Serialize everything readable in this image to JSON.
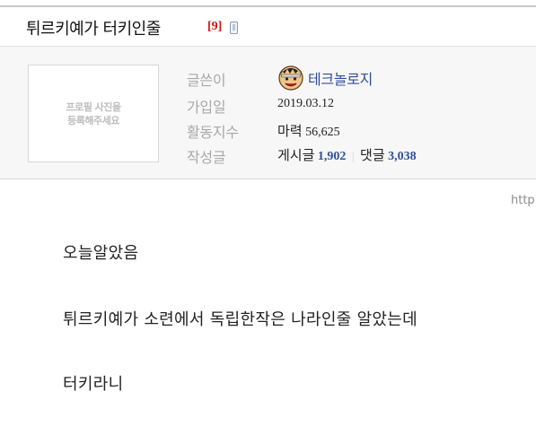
{
  "post": {
    "title": "튀르키예가 터키인줄",
    "comment_count": "[9]",
    "mobile_icon": "mobile-phone-icon"
  },
  "profile": {
    "photo_placeholder_line1": "프로필 사진을",
    "photo_placeholder_line2": "등록해주세요",
    "labels": {
      "author": "글쓴이",
      "joined": "가입일",
      "activity": "활동지수",
      "posts": "작성글"
    },
    "nickname": "테크놀로지",
    "joined_date": "2019.03.12",
    "activity_label": "마력",
    "activity_value": "56,625",
    "post_label": "게시글",
    "post_count": "1,902",
    "comment_label": "댓글",
    "comment_count": "3,038",
    "separator": "|"
  },
  "url_hint": "http",
  "content": {
    "line1": "오늘알았음",
    "line2": "튀르키예가 소련에서 독립한작은 나라인줄 알았는데",
    "line3": "터키라니"
  },
  "colors": {
    "comment_count": "#d01818",
    "nickname": "#2f4f9e",
    "label": "#a8a8a8",
    "profile_bg": "#f7f7f7"
  }
}
